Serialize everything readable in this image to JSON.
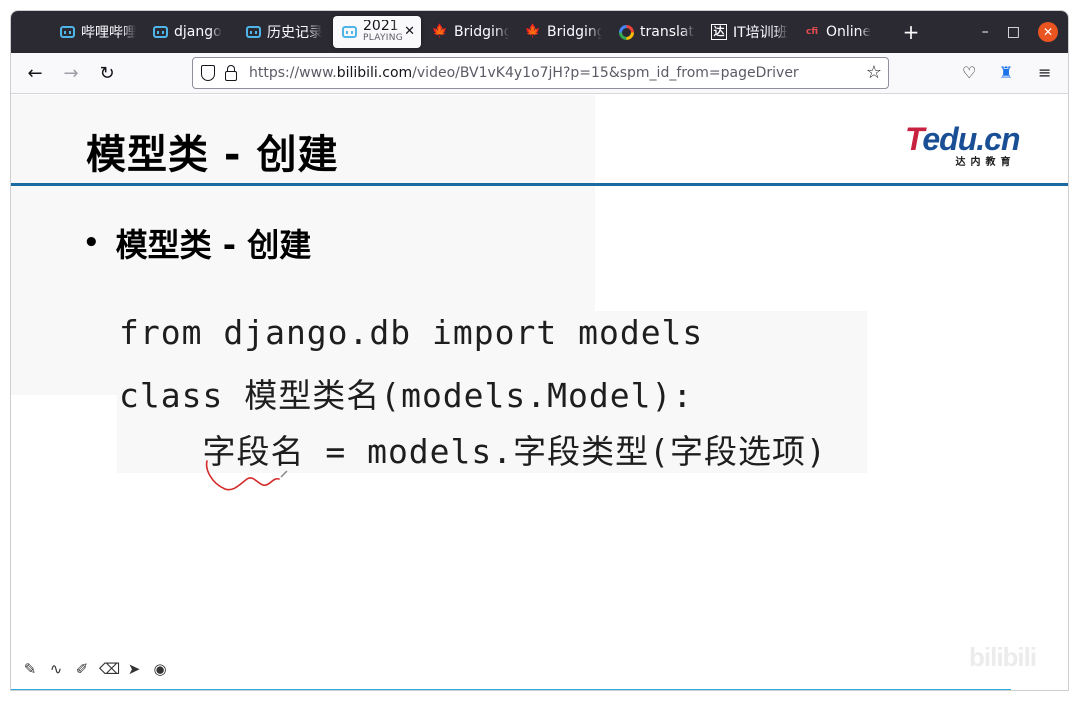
{
  "browser": {
    "tabs": [
      {
        "label": "哔哩哔哩",
        "icon": "bilibili-icon"
      },
      {
        "label": "django",
        "icon": "bilibili-icon"
      },
      {
        "label": "历史记录",
        "icon": "bilibili-icon"
      },
      {
        "label": "2021",
        "sublabel": "PLAYING",
        "icon": "bilibili-icon",
        "active": true
      },
      {
        "label": "Bridging",
        "icon": "maple-leaf-icon"
      },
      {
        "label": "Bridging",
        "icon": "maple-leaf-icon"
      },
      {
        "label": "translate",
        "icon": "google-icon"
      },
      {
        "label": "IT培训班",
        "icon": "da-icon"
      },
      {
        "label": "Online",
        "icon": "cfi-icon"
      }
    ],
    "new_tab": "+",
    "window_controls": {
      "minimize": "–",
      "maximize": "□",
      "close": "✕"
    },
    "url_prefix": "https://www.",
    "url_domain": "bilibili.com",
    "url_path": "/video/BV1vK4y1o7jH?p=15&spm_id_from=pageDriver"
  },
  "slide": {
    "title": "模型类 - 创建",
    "bullet": "模型类 - 创建",
    "bullet_marker": "•",
    "logo_main": "edu.cn",
    "logo_t": "T",
    "logo_sub": "达内教育",
    "code": [
      "from django.db import models",
      "class 模型类名(models.Model):",
      "    字段名 = models.字段类型(字段选项)"
    ],
    "watermark": "bilibili"
  },
  "colors": {
    "rule": "#1c6aa3",
    "logo_blue": "#1a4f96",
    "logo_red": "#c8203f",
    "squiggle": "#d42a2a",
    "progress": "#2daadb"
  }
}
